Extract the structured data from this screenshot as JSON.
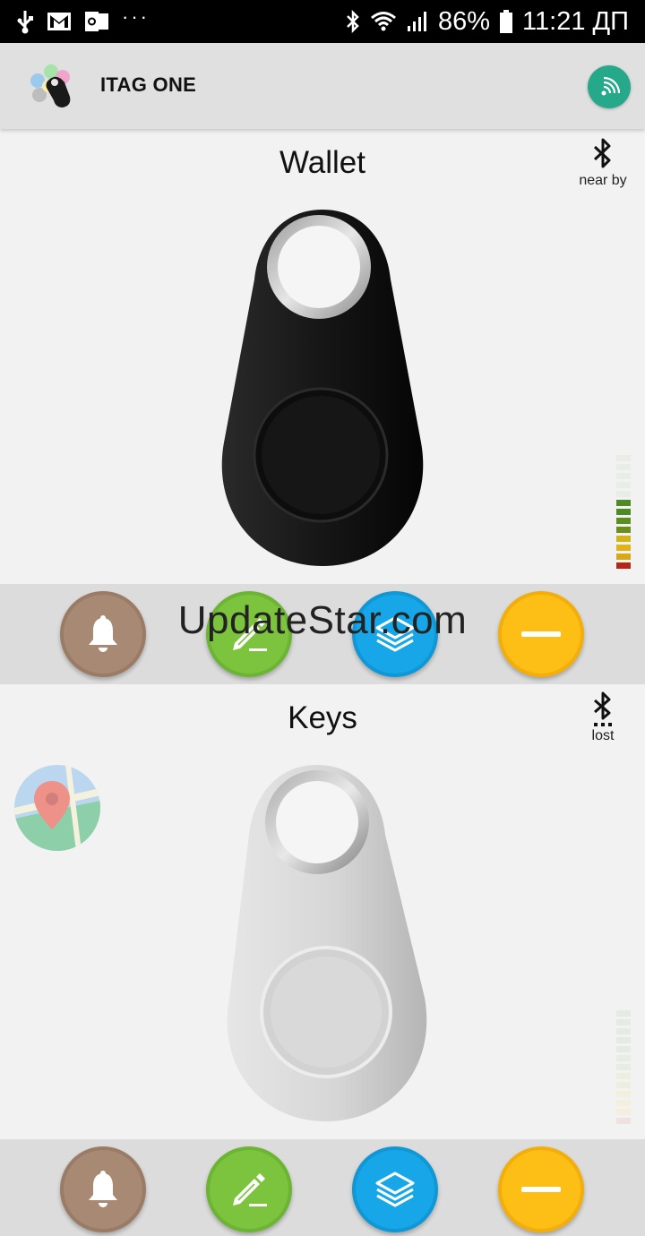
{
  "status_bar": {
    "battery_percent": "86%",
    "time": "11:21 ДП",
    "dots": "···"
  },
  "app_bar": {
    "title": "ITAG ONE"
  },
  "tags": [
    {
      "name": "Wallet",
      "bt_status": "near by",
      "color": "#111111",
      "signal_level": 0.6
    },
    {
      "name": "Keys",
      "bt_status": "lost",
      "color": "#d8d8d8",
      "signal_level": 0
    }
  ],
  "action_colors": {
    "alert": "#a88a74",
    "edit": "#7cc43e",
    "stack": "#17a7e8",
    "remove": "#fdbe16"
  },
  "watermark": "UpdateStar.com"
}
